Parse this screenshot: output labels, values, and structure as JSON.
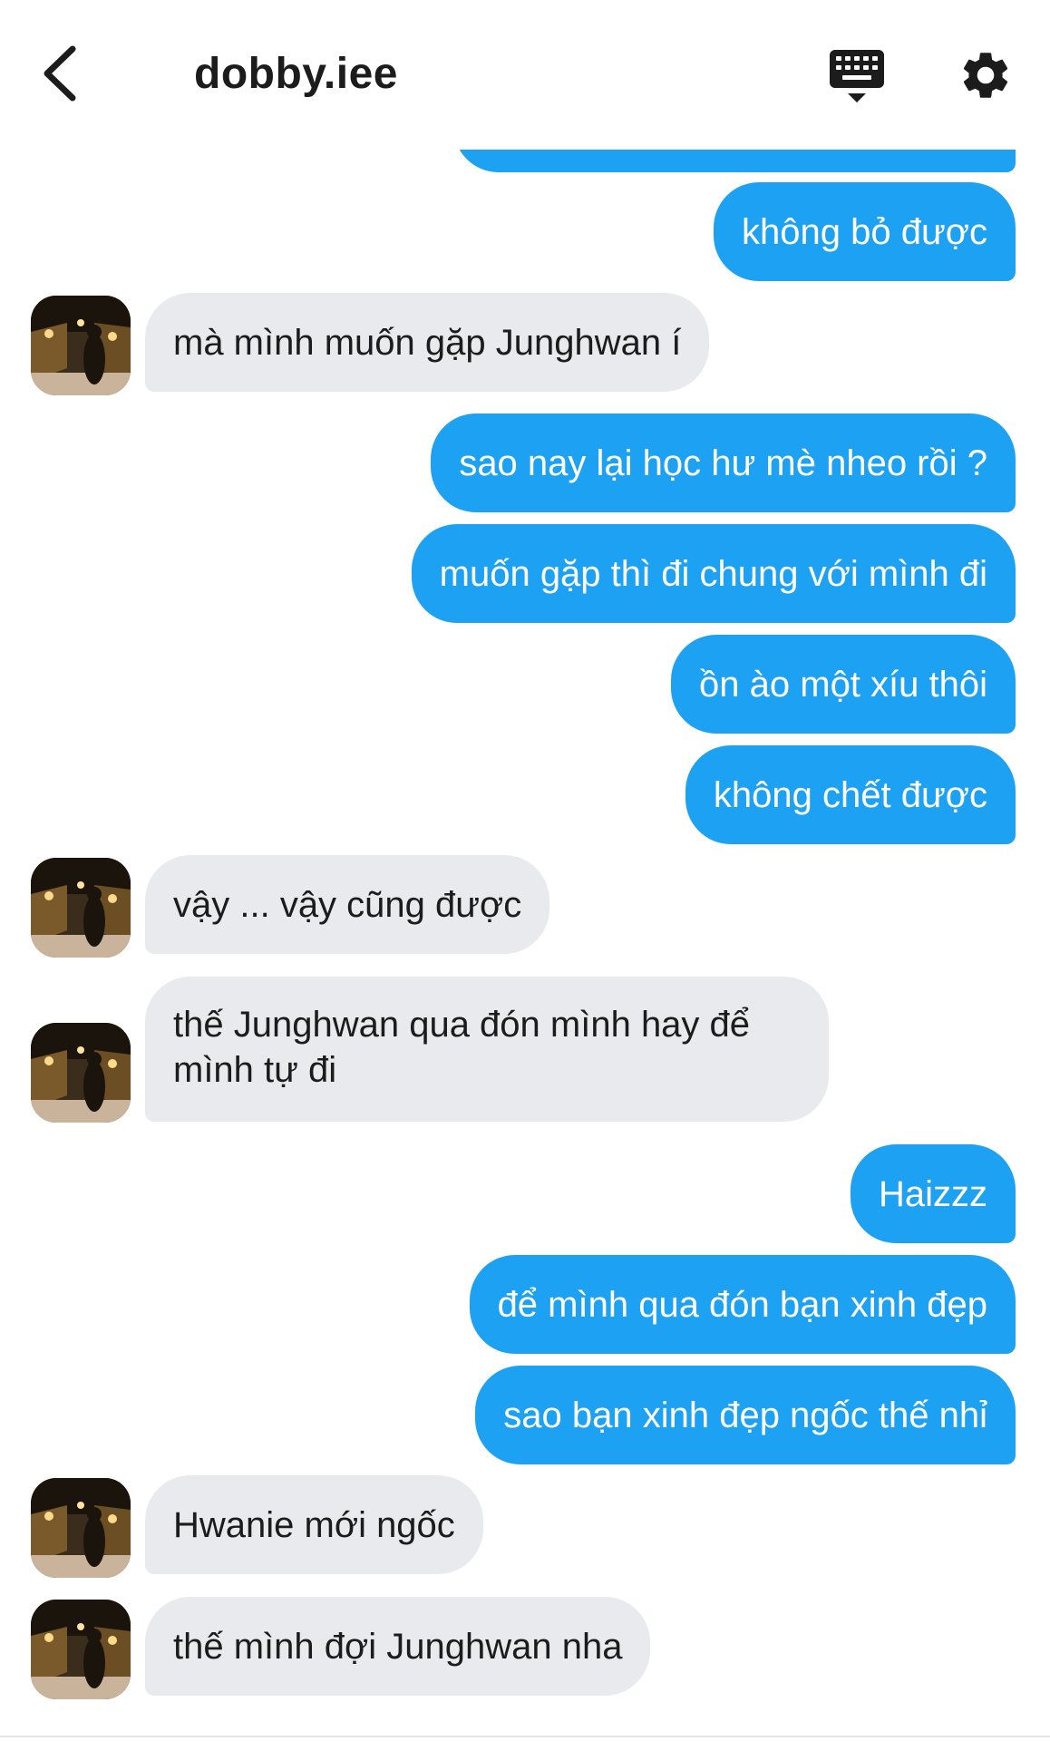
{
  "header": {
    "back_icon": "chevron-left-icon",
    "title": "dobby.iee",
    "keyboard_icon": "keyboard-icon",
    "settings_icon": "gear-icon"
  },
  "colors": {
    "sent_bubble": "#1da1f2",
    "received_bubble": "#e8eaed",
    "text_dark": "#1c1c1c"
  },
  "messages": [
    {
      "sender": "me",
      "text": ""
    },
    {
      "sender": "me",
      "text": "không bỏ được"
    },
    {
      "sender": "them",
      "text": "mà mình muốn gặp Junghwan í"
    },
    {
      "sender": "me",
      "text": "sao nay lại học hư mè nheo rồi ?"
    },
    {
      "sender": "me",
      "text": "muốn gặp thì đi chung với mình đi"
    },
    {
      "sender": "me",
      "text": "ồn ào một xíu thôi"
    },
    {
      "sender": "me",
      "text": "không chết được"
    },
    {
      "sender": "them",
      "text": "vậy ... vậy cũng được"
    },
    {
      "sender": "them",
      "text": "thế Junghwan qua đón mình hay để mình tự đi"
    },
    {
      "sender": "me",
      "text": "Haizzz"
    },
    {
      "sender": "me",
      "text": "để mình qua đón bạn xinh đẹp"
    },
    {
      "sender": "me",
      "text": "sao bạn xinh đẹp ngốc thế nhỉ"
    },
    {
      "sender": "them",
      "text": "Hwanie mới ngốc"
    },
    {
      "sender": "them",
      "text": "thế mình đợi Junghwan nha"
    }
  ]
}
